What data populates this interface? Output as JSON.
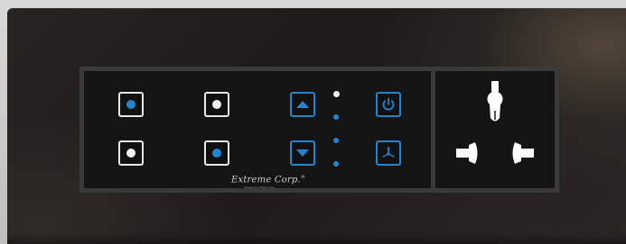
{
  "logo": {
    "brand": "Extreme Corp.",
    "mark": "®",
    "tagline": "Simply touching home"
  },
  "colors": {
    "accent_blue": "#1f86d3",
    "white": "#f2f2f2",
    "frame": "#c8c8c8",
    "glass": "#211f1d",
    "panel": "#141414",
    "panel_border": "#3a3a3a"
  },
  "switches": [
    {
      "name": "switch-1",
      "led": "blue"
    },
    {
      "name": "switch-2",
      "led": "white"
    },
    {
      "name": "switch-3",
      "led": "white"
    },
    {
      "name": "switch-4",
      "led": "blue"
    }
  ],
  "fan_controls": {
    "up_icon": "triangle-up-icon",
    "down_icon": "triangle-down-icon",
    "power_icon": "power-icon",
    "fan_icon": "fan-icon",
    "speed_indicators": [
      "white",
      "blue",
      "blue",
      "blue"
    ]
  },
  "socket": {
    "type": "universal socket",
    "pins": 3
  }
}
